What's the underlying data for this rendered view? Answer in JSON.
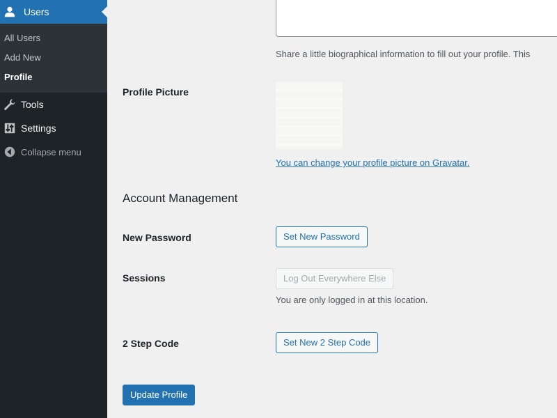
{
  "sidebar": {
    "users_label": "Users",
    "submenu": [
      "All Users",
      "Add New",
      "Profile"
    ],
    "current_submenu": "Profile",
    "tools_label": "Tools",
    "settings_label": "Settings",
    "collapse_label": "Collapse menu"
  },
  "profile": {
    "bio_description": "Share a little biographical information to fill out your profile. This",
    "picture_label": "Profile Picture",
    "gravatar_link": "You can change your profile picture on Gravatar",
    "gravatar_period": ".",
    "account_heading": "Account Management",
    "new_password_label": "New Password",
    "set_password_button": "Set New Password",
    "sessions_label": "Sessions",
    "logout_button": "Log Out Everywhere Else",
    "sessions_description": "You are only logged in at this location.",
    "two_step_label": "2 Step Code",
    "two_step_button": "Set New 2 Step Code",
    "update_button": "Update Profile"
  },
  "colors": {
    "accent": "#2271b1",
    "sidebar_bg": "#1d2327",
    "submenu_bg": "#2c3338",
    "page_bg": "#f0f0f1"
  },
  "icons": {
    "users": "user-icon",
    "tools": "wrench-icon",
    "settings": "settings-icon",
    "collapse": "collapse-icon"
  }
}
